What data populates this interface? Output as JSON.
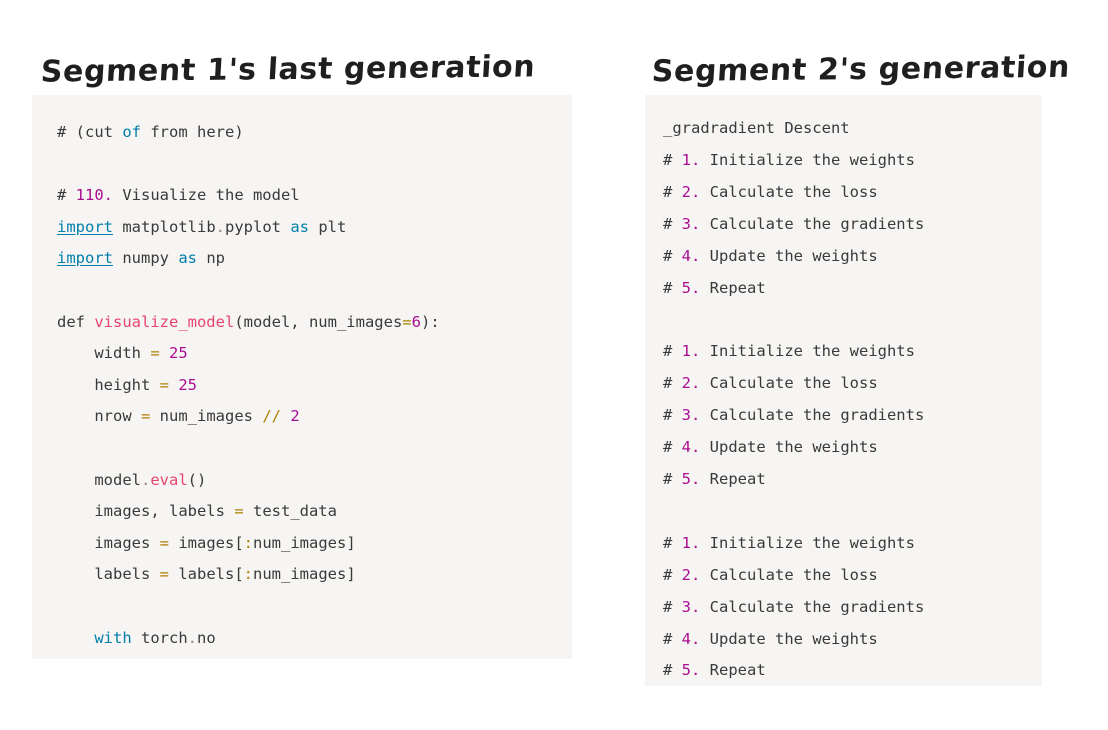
{
  "page": {
    "background_color": "#ffffff",
    "panel_background_color": "#f6f5f3"
  },
  "headings": {
    "left": "Segment 1's last generation",
    "right": "Segment 2's generation"
  },
  "palette": {
    "plain": "#3a3a3a",
    "keyword": "#007faa",
    "number": "#aa0d91",
    "function": "#e8446d",
    "operator": "#b08000",
    "punctuation": "#3a3a3a"
  },
  "left_panel": {
    "language": "python",
    "lines": [
      [
        {
          "t": "# (cut ",
          "c": "comment"
        },
        {
          "t": "of",
          "c": "kw"
        },
        {
          "t": " from here)",
          "c": "comment"
        }
      ],
      [
        {
          "t": "",
          "c": "plain"
        }
      ],
      [
        {
          "t": "# ",
          "c": "comment"
        },
        {
          "t": "110.",
          "c": "num"
        },
        {
          "t": " Visualize the model",
          "c": "comment"
        }
      ],
      [
        {
          "t": "import",
          "c": "kw-u"
        },
        {
          "t": " matplotlib",
          "c": "plain"
        },
        {
          "t": ".",
          "c": "dot"
        },
        {
          "t": "pyplot ",
          "c": "plain"
        },
        {
          "t": "as",
          "c": "kw"
        },
        {
          "t": " plt",
          "c": "plain"
        }
      ],
      [
        {
          "t": "import",
          "c": "kw-u"
        },
        {
          "t": " numpy ",
          "c": "plain"
        },
        {
          "t": "as",
          "c": "kw"
        },
        {
          "t": " np",
          "c": "plain"
        }
      ],
      [
        {
          "t": "",
          "c": "plain"
        }
      ],
      [
        {
          "t": "def ",
          "c": "plain"
        },
        {
          "t": "visualize_model",
          "c": "func"
        },
        {
          "t": "(model, num_images",
          "c": "plain"
        },
        {
          "t": "=",
          "c": "op"
        },
        {
          "t": "6",
          "c": "num"
        },
        {
          "t": "):",
          "c": "plain"
        }
      ],
      [
        {
          "t": "    width ",
          "c": "plain"
        },
        {
          "t": "=",
          "c": "op"
        },
        {
          "t": " ",
          "c": "plain"
        },
        {
          "t": "25",
          "c": "num"
        }
      ],
      [
        {
          "t": "    height ",
          "c": "plain"
        },
        {
          "t": "=",
          "c": "op"
        },
        {
          "t": " ",
          "c": "plain"
        },
        {
          "t": "25",
          "c": "num"
        }
      ],
      [
        {
          "t": "    nrow ",
          "c": "plain"
        },
        {
          "t": "=",
          "c": "op"
        },
        {
          "t": " num_images ",
          "c": "plain"
        },
        {
          "t": "//",
          "c": "op"
        },
        {
          "t": " ",
          "c": "plain"
        },
        {
          "t": "2",
          "c": "num"
        }
      ],
      [
        {
          "t": "",
          "c": "plain"
        }
      ],
      [
        {
          "t": "    model",
          "c": "plain"
        },
        {
          "t": ".",
          "c": "dot"
        },
        {
          "t": "eval",
          "c": "func"
        },
        {
          "t": "()",
          "c": "plain"
        }
      ],
      [
        {
          "t": "    images, labels ",
          "c": "plain"
        },
        {
          "t": "=",
          "c": "op"
        },
        {
          "t": " test_data",
          "c": "plain"
        }
      ],
      [
        {
          "t": "    images ",
          "c": "plain"
        },
        {
          "t": "=",
          "c": "op"
        },
        {
          "t": " images",
          "c": "plain"
        },
        {
          "t": "[",
          "c": "punc"
        },
        {
          "t": ":",
          "c": "op"
        },
        {
          "t": "num_images",
          "c": "plain"
        },
        {
          "t": "]",
          "c": "punc"
        }
      ],
      [
        {
          "t": "    labels ",
          "c": "plain"
        },
        {
          "t": "=",
          "c": "op"
        },
        {
          "t": " labels",
          "c": "plain"
        },
        {
          "t": "[",
          "c": "punc"
        },
        {
          "t": ":",
          "c": "op"
        },
        {
          "t": "num_images",
          "c": "plain"
        },
        {
          "t": "]",
          "c": "punc"
        }
      ],
      [
        {
          "t": "",
          "c": "plain"
        }
      ],
      [
        {
          "t": "    ",
          "c": "plain"
        },
        {
          "t": "with",
          "c": "kw"
        },
        {
          "t": " torch",
          "c": "plain"
        },
        {
          "t": ".",
          "c": "dot"
        },
        {
          "t": "no",
          "c": "plain"
        }
      ]
    ],
    "plain_text": "# (cut of from here)\n\n# 110. Visualize the model\nimport matplotlib.pyplot as plt\nimport numpy as np\n\ndef visualize_model(model, num_images=6):\n    width = 25\n    height = 25\n    nrow = num_images // 2\n\n    model.eval()\n    images, labels = test_data\n    images = images[:num_images]\n    labels = labels[:num_images]\n\n    with torch.no"
  },
  "right_panel": {
    "language": "python",
    "lines": [
      [
        {
          "t": "_gradradient Descent",
          "c": "plain"
        }
      ],
      [
        {
          "t": "# ",
          "c": "comment"
        },
        {
          "t": "1.",
          "c": "num"
        },
        {
          "t": " Initialize the weights",
          "c": "comment"
        }
      ],
      [
        {
          "t": "# ",
          "c": "comment"
        },
        {
          "t": "2.",
          "c": "num"
        },
        {
          "t": " Calculate the loss",
          "c": "comment"
        }
      ],
      [
        {
          "t": "# ",
          "c": "comment"
        },
        {
          "t": "3.",
          "c": "num"
        },
        {
          "t": " Calculate the gradients",
          "c": "comment"
        }
      ],
      [
        {
          "t": "# ",
          "c": "comment"
        },
        {
          "t": "4.",
          "c": "num"
        },
        {
          "t": " Update the weights",
          "c": "comment"
        }
      ],
      [
        {
          "t": "# ",
          "c": "comment"
        },
        {
          "t": "5.",
          "c": "num"
        },
        {
          "t": " Repeat",
          "c": "comment"
        }
      ],
      [
        {
          "t": "",
          "c": "plain"
        }
      ],
      [
        {
          "t": "# ",
          "c": "comment"
        },
        {
          "t": "1.",
          "c": "num"
        },
        {
          "t": " Initialize the weights",
          "c": "comment"
        }
      ],
      [
        {
          "t": "# ",
          "c": "comment"
        },
        {
          "t": "2.",
          "c": "num"
        },
        {
          "t": " Calculate the loss",
          "c": "comment"
        }
      ],
      [
        {
          "t": "# ",
          "c": "comment"
        },
        {
          "t": "3.",
          "c": "num"
        },
        {
          "t": " Calculate the gradients",
          "c": "comment"
        }
      ],
      [
        {
          "t": "# ",
          "c": "comment"
        },
        {
          "t": "4.",
          "c": "num"
        },
        {
          "t": " Update the weights",
          "c": "comment"
        }
      ],
      [
        {
          "t": "# ",
          "c": "comment"
        },
        {
          "t": "5.",
          "c": "num"
        },
        {
          "t": " Repeat",
          "c": "comment"
        }
      ],
      [
        {
          "t": "",
          "c": "plain"
        }
      ],
      [
        {
          "t": "# ",
          "c": "comment"
        },
        {
          "t": "1.",
          "c": "num"
        },
        {
          "t": " Initialize the weights",
          "c": "comment"
        }
      ],
      [
        {
          "t": "# ",
          "c": "comment"
        },
        {
          "t": "2.",
          "c": "num"
        },
        {
          "t": " Calculate the loss",
          "c": "comment"
        }
      ],
      [
        {
          "t": "# ",
          "c": "comment"
        },
        {
          "t": "3.",
          "c": "num"
        },
        {
          "t": " Calculate the gradients",
          "c": "comment"
        }
      ],
      [
        {
          "t": "# ",
          "c": "comment"
        },
        {
          "t": "4.",
          "c": "num"
        },
        {
          "t": " Update the weights",
          "c": "comment"
        }
      ],
      [
        {
          "t": "# ",
          "c": "comment"
        },
        {
          "t": "5.",
          "c": "num"
        },
        {
          "t": " Repeat",
          "c": "comment"
        }
      ]
    ],
    "plain_text": "_gradradient Descent\n# 1. Initialize the weights\n# 2. Calculate the loss\n# 3. Calculate the gradients\n# 4. Update the weights\n# 5. Repeat\n\n# 1. Initialize the weights\n# 2. Calculate the loss\n# 3. Calculate the gradients\n# 4. Update the weights\n# 5. Repeat\n\n# 1. Initialize the weights\n# 2. Calculate the loss\n# 3. Calculate the gradients\n# 4. Update the weights\n# 5. Repeat"
  }
}
